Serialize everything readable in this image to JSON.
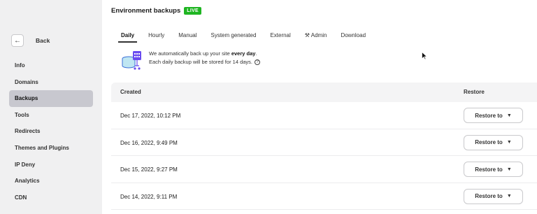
{
  "sidebar": {
    "back_label": "Back",
    "items": [
      {
        "label": "Info",
        "active": false
      },
      {
        "label": "Domains",
        "active": false
      },
      {
        "label": "Backups",
        "active": true
      },
      {
        "label": "Tools",
        "active": false
      },
      {
        "label": "Redirects",
        "active": false
      },
      {
        "label": "Themes and Plugins",
        "active": false
      },
      {
        "label": "IP Deny",
        "active": false
      },
      {
        "label": "Analytics",
        "active": false
      },
      {
        "label": "CDN",
        "active": false
      }
    ]
  },
  "header": {
    "title": "Environment backups",
    "badge": "LIVE",
    "badge_color": "#1fb522"
  },
  "tabs": [
    {
      "label": "Daily",
      "active": true
    },
    {
      "label": "Hourly",
      "active": false
    },
    {
      "label": "Manual",
      "active": false
    },
    {
      "label": "System generated",
      "active": false
    },
    {
      "label": "External",
      "active": false
    },
    {
      "label": "Admin",
      "active": false,
      "icon": "wrench-icon"
    },
    {
      "label": "Download",
      "active": false
    }
  ],
  "info": {
    "line1_prefix": "We automatically back up your site ",
    "line1_bold": "every day",
    "line1_suffix": ".",
    "line2": "Each daily backup will be stored for 14 days."
  },
  "table": {
    "col_created": "Created",
    "col_restore": "Restore",
    "restore_button_label": "Restore to",
    "rows": [
      {
        "created": "Dec 17, 2022, 10:12 PM"
      },
      {
        "created": "Dec 16, 2022, 9:49 PM"
      },
      {
        "created": "Dec 15, 2022, 9:27 PM"
      },
      {
        "created": "Dec 14, 2022, 9:11 PM"
      }
    ]
  }
}
